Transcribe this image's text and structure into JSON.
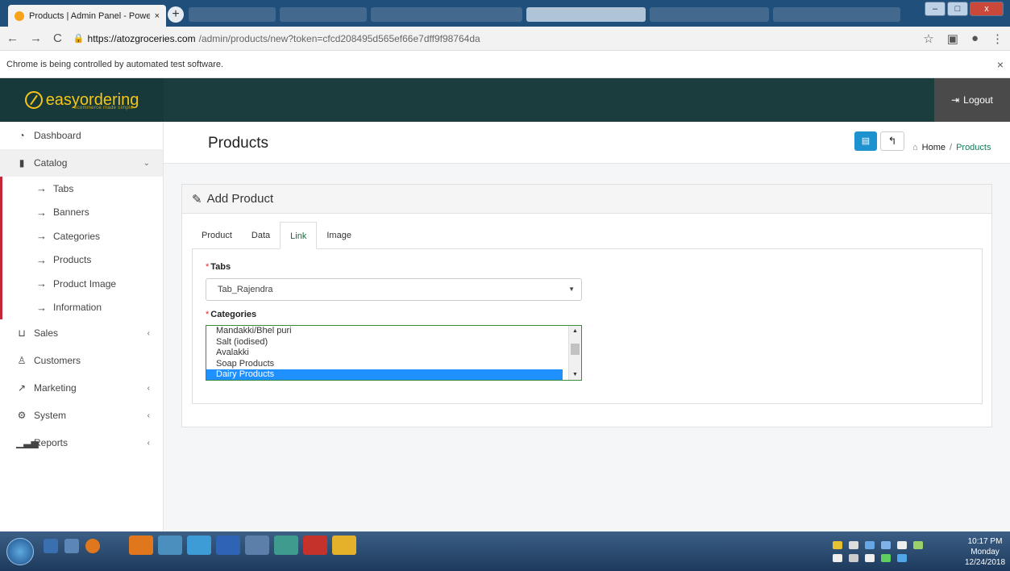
{
  "browser": {
    "tab_title": "Products | Admin Panel - Powere",
    "tab_close": "×",
    "new_tab": "+",
    "url_host": "https://atozgroceries.com",
    "url_path": "/admin/products/new?token=cfcd208495d565ef66e7dff9f98764da",
    "infobar_text": "Chrome is being controlled by automated test software.",
    "infobar_close": "×",
    "min_label": "–",
    "max_label": "□",
    "close_label": "x"
  },
  "header": {
    "brand": "easyordering",
    "brand_tagline": "ecommerce made simple",
    "logout": "Logout"
  },
  "sidebar": {
    "items": [
      {
        "label": "Dashboard",
        "icon": "dashboard-icon"
      },
      {
        "label": "Catalog",
        "icon": "tag-icon"
      },
      {
        "label": "Sales",
        "icon": "cart-icon"
      },
      {
        "label": "Customers",
        "icon": "user-icon"
      },
      {
        "label": "Marketing",
        "icon": "share-icon"
      },
      {
        "label": "System",
        "icon": "cog-icon"
      },
      {
        "label": "Reports",
        "icon": "bar-chart-icon"
      }
    ],
    "catalog_sub": [
      "Tabs",
      "Banners",
      "Categories",
      "Products",
      "Product Image",
      "Information"
    ]
  },
  "page": {
    "title": "Products",
    "breadcrumb_home": "Home",
    "breadcrumb_sep": "/",
    "breadcrumb_current": "Products"
  },
  "panel": {
    "title": "Add Product",
    "tabs": [
      "Product",
      "Data",
      "Link",
      "Image"
    ],
    "active_tab": "Link",
    "tabs_label": "Tabs",
    "tabs_value": "Tab_Rajendra",
    "categories_label": "Categories",
    "categories_options": [
      "Mandakki/Bhel puri",
      "Salt (iodised)",
      "Avalakki",
      "Soap Products",
      "Dairy Products"
    ],
    "categories_selected": "Dairy Products",
    "required_mark": "*"
  },
  "taskbar": {
    "time": "10:17 PM",
    "day": "Monday",
    "date": "12/24/2018"
  },
  "colors": {
    "header_bg": "#1c3d3e",
    "brand_yellow": "#f5c518",
    "primary_button": "#1e91cf",
    "sidebar_accent": "#c4263a",
    "selected_option": "#1e90ff"
  }
}
